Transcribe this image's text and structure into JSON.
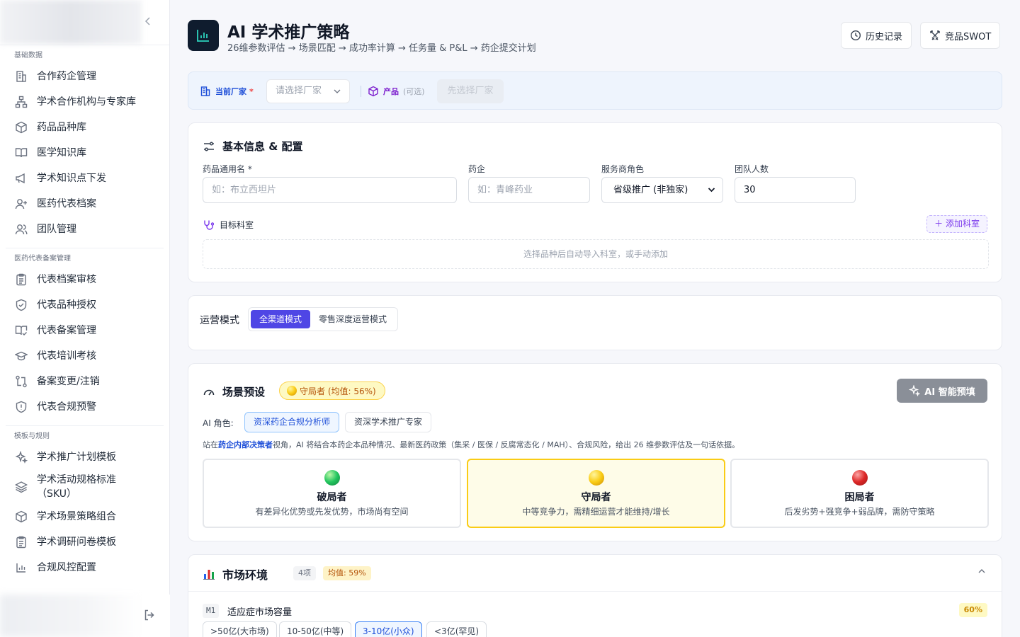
{
  "sidebar": {
    "sections": [
      {
        "title": "基础数据",
        "items": [
          "合作药企管理",
          "学术合作机构与专家库",
          "药品品种库",
          "医学知识库",
          "学术知识点下发",
          "医药代表档案",
          "团队管理"
        ]
      },
      {
        "title": "医药代表备案管理",
        "items": [
          "代表档案审核",
          "代表品种授权",
          "代表备案管理",
          "代表培训考核",
          "备案变更/注销",
          "代表合规预警"
        ]
      },
      {
        "title": "模板与规则",
        "items": [
          "学术推广计划模板",
          "学术活动规格标准（SKU）",
          "学术场景策略组合",
          "学术调研问卷模板",
          "合规风控配置"
        ]
      }
    ]
  },
  "header": {
    "title": "AI 学术推广策略",
    "subtitle": "26维参数评估 → 场景匹配 → 成功率计算 → 任务量 & P&L → 药企提交计划",
    "history_btn": "历史记录",
    "swot_btn": "竞品SWOT"
  },
  "vendor_bar": {
    "vendor_label": "当前厂家",
    "required_mark": "*",
    "vendor_placeholder": "请选择厂家",
    "product_label": "产品",
    "product_optional": "(可选)",
    "product_placeholder": "先选择厂家"
  },
  "basic_info": {
    "title": "基本信息 & 配置",
    "drug_label": "药品通用名 *",
    "drug_placeholder": "如：布立西坦片",
    "company_label": "药企",
    "company_placeholder": "如：青峰药业",
    "role_label": "服务商角色",
    "role_value": "省级推广 (非独家)",
    "team_label": "团队人数",
    "team_value": "30",
    "dept_label": "目标科室",
    "add_dept": "＋ 添加科室",
    "dept_empty": "选择品种后自动导入科室，或手动添加"
  },
  "operation_mode": {
    "label": "运营模式",
    "options": [
      "全渠道模式",
      "零售深度运营模式"
    ],
    "active_index": 0
  },
  "scenario": {
    "title": "场景预设",
    "badge": "守局者 (均值: 56%)",
    "ai_btn": "AI 智能预填",
    "role_label": "AI 角色:",
    "roles": [
      "资深药企合规分析师",
      "资深学术推广专家"
    ],
    "active_role": 0,
    "desc_prefix": "站在",
    "desc_highlight": "药企内部决策者",
    "desc_suffix": "视角，AI 将结合本药企本品种情况、最新医药政策（集采 / 医保 / 反腐常态化 / MAH）、合规风险，给出 26 维参数评估及一句话依据。",
    "cards": [
      {
        "name": "破局者",
        "desc": "有差异化优势或先发优势，市场尚有空间",
        "color": "green"
      },
      {
        "name": "守局者",
        "desc": "中等竞争力，需精细运营才能维持/增长",
        "color": "yellow"
      },
      {
        "name": "困局者",
        "desc": "后发劣势+强竞争+弱品牌，需防守策略",
        "color": "red"
      }
    ],
    "selected_index": 1
  },
  "market_env": {
    "title": "市场环境",
    "count": "4项",
    "avg": "均值: 59%",
    "items": [
      {
        "code": "M1",
        "name": "适应症市场容量",
        "pct": "60%",
        "options": [
          ">50亿(大市场)",
          "10-50亿(中等)",
          "3-10亿(小众)",
          "<3亿(罕见)"
        ],
        "selected": 2
      }
    ]
  }
}
